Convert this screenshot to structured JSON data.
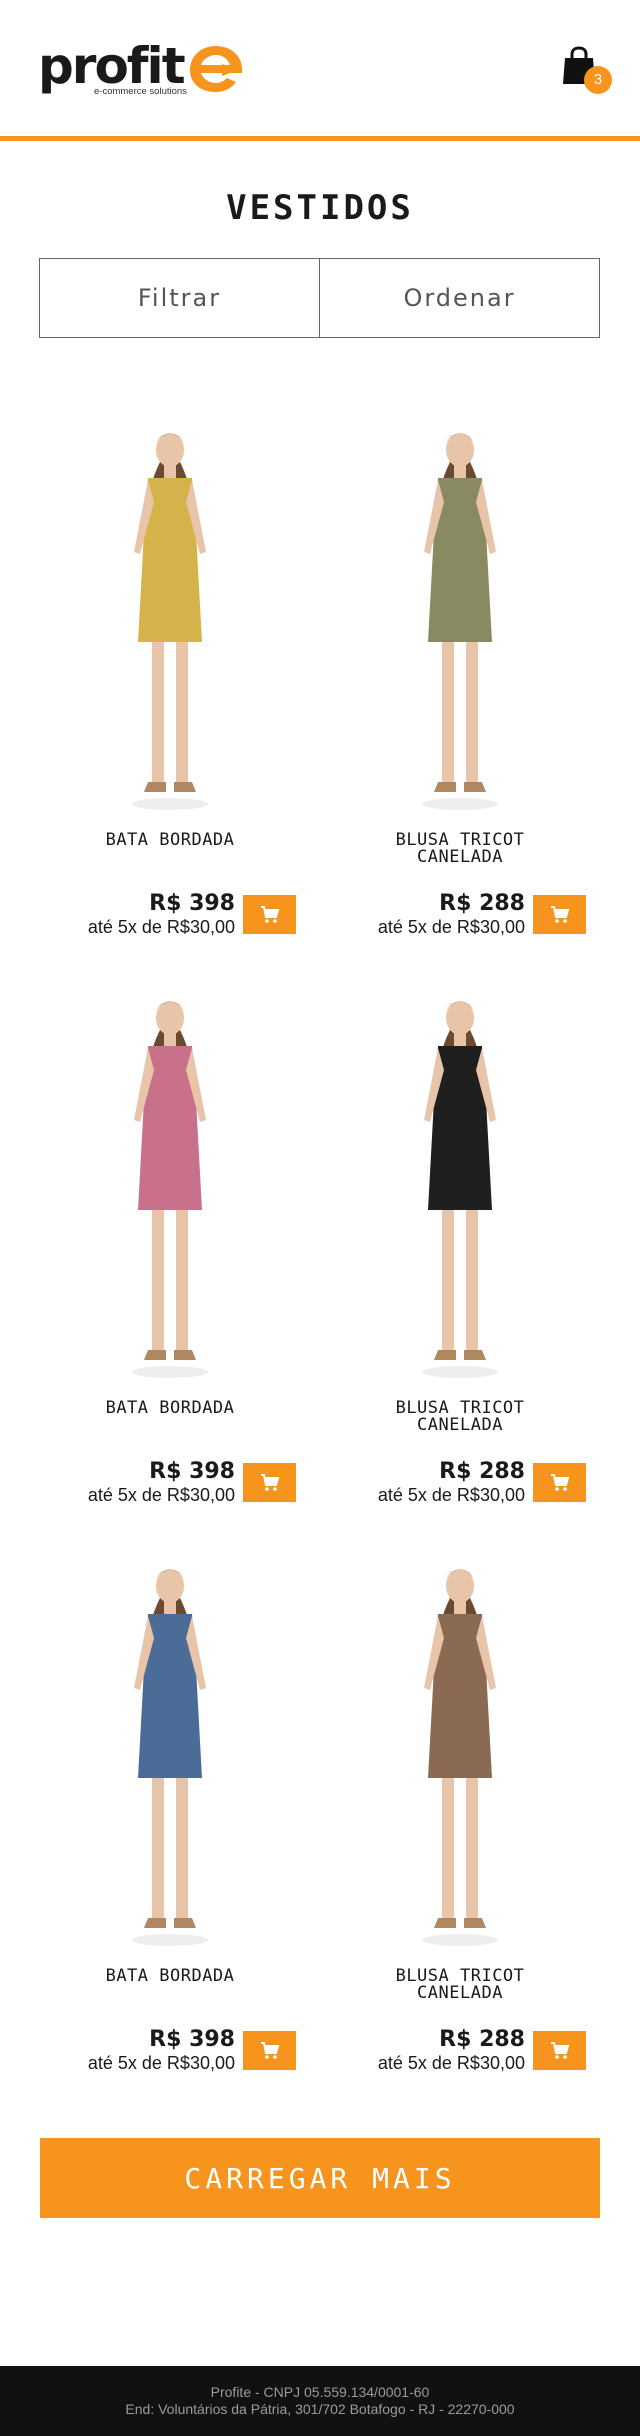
{
  "brand": {
    "name": "profit",
    "tagline": "e-commerce solutions",
    "accent_color": "#f7941d"
  },
  "cart": {
    "count": "3",
    "icon": "shopping-bag-icon"
  },
  "page": {
    "title": "VESTIDOS"
  },
  "toolbar": {
    "filter_label": "Filtrar",
    "sort_label": "Ordenar"
  },
  "products": [
    {
      "name": "BATA BORDADA",
      "price": "R$ 398",
      "installments": "até 5x de R$30,00",
      "dress_color": "#d4b34a"
    },
    {
      "name": "BLUSA TRICOT\nCANELADA",
      "price": "R$ 288",
      "installments": "até 5x de R$30,00",
      "dress_color": "#8a8a62"
    },
    {
      "name": "BATA BORDADA",
      "price": "R$ 398",
      "installments": "até 5x de R$30,00",
      "dress_color": "#c9708a"
    },
    {
      "name": "BLUSA TRICOT\nCANELADA",
      "price": "R$ 288",
      "installments": "até 5x de R$30,00",
      "dress_color": "#1f1f1f"
    },
    {
      "name": "BATA BORDADA",
      "price": "R$ 398",
      "installments": "até 5x de R$30,00",
      "dress_color": "#4c6c98"
    },
    {
      "name": "BLUSA TRICOT\nCANELADA",
      "price": "R$ 288",
      "installments": "até 5x de R$30,00",
      "dress_color": "#8a6a52"
    }
  ],
  "load_more_label": "CARREGAR MAIS",
  "footer": {
    "line1": "Profite - CNPJ 05.559.134/0001-60",
    "line2": "End: Voluntários da Pátria, 301/702 Botafogo - RJ - 22270-000"
  }
}
